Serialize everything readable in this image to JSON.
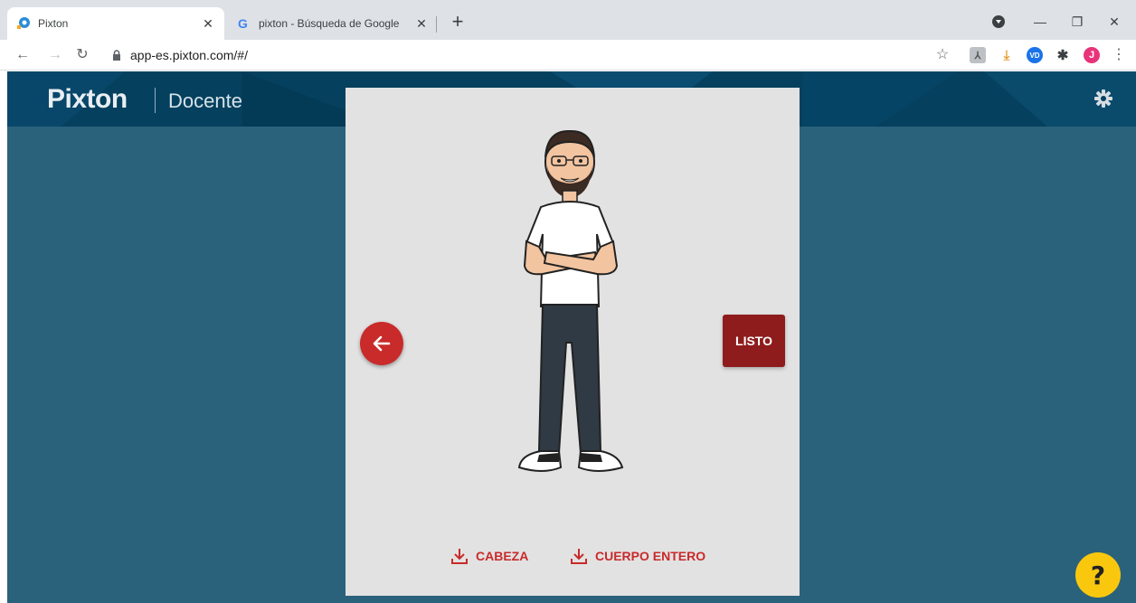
{
  "browser": {
    "tabs": [
      {
        "title": "Pixton",
        "icon": "pixton-favicon"
      },
      {
        "title": "pixton - Búsqueda de Google",
        "icon": "google-favicon"
      }
    ],
    "url": "app-es.pixton.com/#/",
    "profile_initial": "J",
    "ext_vd": "VD"
  },
  "app": {
    "logo": "Pixton",
    "section": "Docente"
  },
  "editor": {
    "done_label": "LISTO",
    "downloads": [
      {
        "label": "CABEZA"
      },
      {
        "label": "CUERPO ENTERO"
      }
    ]
  },
  "help": {
    "label": "?"
  },
  "colors": {
    "app_bg": "#2b627b",
    "header_bg": "#05405e",
    "accent_red": "#c92a2a",
    "done_red": "#8e1c1c",
    "help_yellow": "#f9c80e"
  }
}
